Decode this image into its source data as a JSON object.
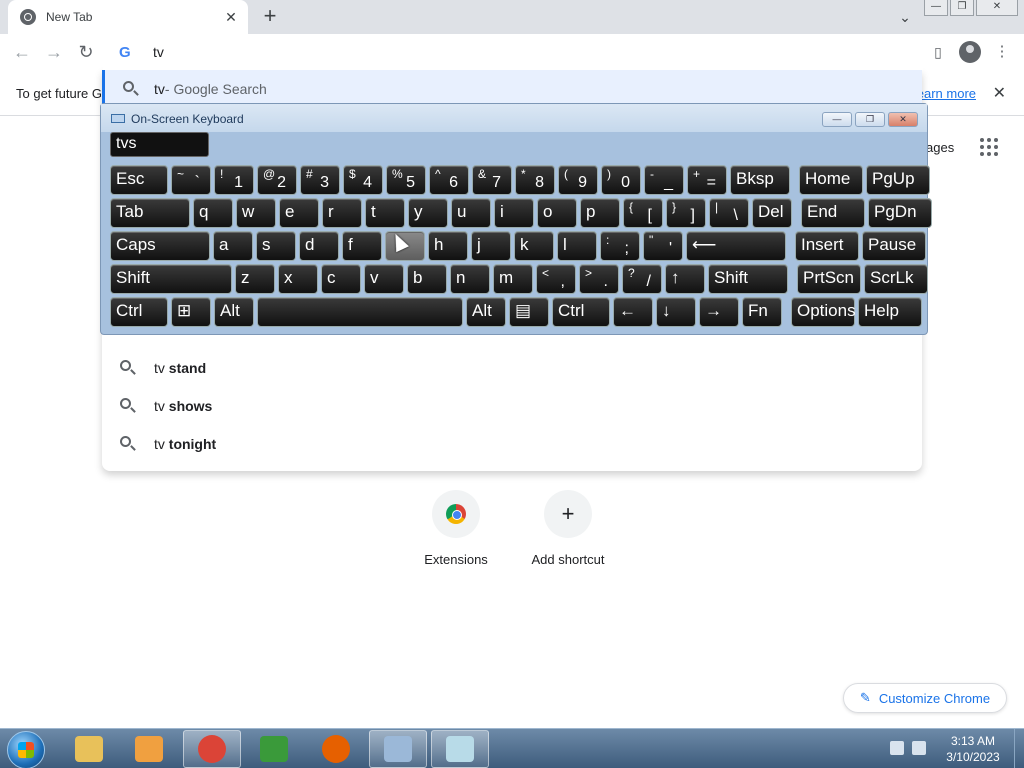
{
  "browser": {
    "tab_title": "New Tab",
    "tab_close": "✕",
    "new_tab": "+",
    "tab_search": "⌄",
    "win_min": "—",
    "win_max": "❐",
    "win_close": "✕"
  },
  "toolbar": {
    "back": "←",
    "forward": "→",
    "reload": "↻",
    "omnibox_value": "tv",
    "google_logo": "G"
  },
  "infobar": {
    "message": "To get future G",
    "learn_more": "earn more",
    "close": "✕"
  },
  "dropdown": {
    "top_suggestion": {
      "typed": "tv",
      "suffix": " - Google Search"
    },
    "suggestions": [
      {
        "typed": "tv ",
        "rest": "stand"
      },
      {
        "typed": "tv ",
        "rest": "shows"
      },
      {
        "typed": "tv ",
        "rest": "tonight"
      }
    ]
  },
  "ntp": {
    "pages_label": "ages",
    "shortcuts": [
      {
        "label": "Extensions"
      },
      {
        "label": "Add shortcut",
        "icon": "+"
      }
    ],
    "customize": "Customize Chrome",
    "customize_icon": "✎"
  },
  "osk": {
    "title": "On-Screen Keyboard",
    "text": "tvs",
    "rows": [
      [
        {
          "m": "Esc"
        },
        {
          "t": "~",
          "b": "`"
        },
        {
          "t": "!",
          "b": "1"
        },
        {
          "t": "@",
          "b": "2"
        },
        {
          "t": "#",
          "b": "3"
        },
        {
          "t": "$",
          "b": "4"
        },
        {
          "t": "%",
          "b": "5"
        },
        {
          "t": "^",
          "b": "6"
        },
        {
          "t": "&",
          "b": "7"
        },
        {
          "t": "*",
          "b": "8"
        },
        {
          "t": "(",
          "b": "9"
        },
        {
          "t": ")",
          "b": "0"
        },
        {
          "t": "-",
          "b": "_"
        },
        {
          "t": "+",
          "b": "="
        },
        {
          "m": "Bksp"
        },
        {
          "m": "Home"
        },
        {
          "m": "PgUp"
        }
      ],
      [
        {
          "m": "Tab"
        },
        {
          "m": "q"
        },
        {
          "m": "w"
        },
        {
          "m": "e"
        },
        {
          "m": "r"
        },
        {
          "m": "t"
        },
        {
          "m": "y"
        },
        {
          "m": "u"
        },
        {
          "m": "i"
        },
        {
          "m": "o"
        },
        {
          "m": "p"
        },
        {
          "t": "{",
          "b": "["
        },
        {
          "t": "}",
          "b": "]"
        },
        {
          "t": "|",
          "b": "\\"
        },
        {
          "m": "Del"
        },
        {
          "m": "End"
        },
        {
          "m": "PgDn"
        }
      ],
      [
        {
          "m": "Caps"
        },
        {
          "m": "a"
        },
        {
          "m": "s"
        },
        {
          "m": "d"
        },
        {
          "m": "f"
        },
        {
          "m": ""
        },
        {
          "m": "h"
        },
        {
          "m": "j"
        },
        {
          "m": "k"
        },
        {
          "m": "l"
        },
        {
          "t": ":",
          "b": ";"
        },
        {
          "t": "\"",
          "b": "'"
        },
        {
          "m": "⟵"
        },
        {
          "m": "Insert"
        },
        {
          "m": "Pause"
        }
      ],
      [
        {
          "m": "Shift"
        },
        {
          "m": "z"
        },
        {
          "m": "x"
        },
        {
          "m": "c"
        },
        {
          "m": "v"
        },
        {
          "m": "b"
        },
        {
          "m": "n"
        },
        {
          "m": "m"
        },
        {
          "t": "<",
          "b": ","
        },
        {
          "t": ">",
          "b": "."
        },
        {
          "t": "?",
          "b": "/"
        },
        {
          "m": "↑"
        },
        {
          "m": "Shift"
        },
        {
          "m": "PrtScn"
        },
        {
          "m": "ScrLk"
        }
      ],
      [
        {
          "m": "Ctrl"
        },
        {
          "m": "⊞"
        },
        {
          "m": "Alt"
        },
        {
          "m": ""
        },
        {
          "m": "Alt"
        },
        {
          "m": "▤"
        },
        {
          "m": "Ctrl"
        },
        {
          "m": "←"
        },
        {
          "m": "↓"
        },
        {
          "m": "→"
        },
        {
          "m": "Fn"
        },
        {
          "m": "Options"
        },
        {
          "m": "Help"
        }
      ]
    ]
  },
  "taskbar": {
    "clock_time": "3:13 AM",
    "clock_date": "3/10/2023",
    "items": [
      {
        "name": "explorer",
        "color": "#e8c15a"
      },
      {
        "name": "media-player",
        "color": "#f0a040"
      },
      {
        "name": "chrome",
        "color": "#db4437"
      },
      {
        "name": "csharp",
        "color": "#3a9a3a"
      },
      {
        "name": "firefox",
        "color": "#e66000"
      },
      {
        "name": "osk",
        "color": "#9bb8d8"
      },
      {
        "name": "notepad",
        "color": "#b8dbe8"
      }
    ]
  }
}
